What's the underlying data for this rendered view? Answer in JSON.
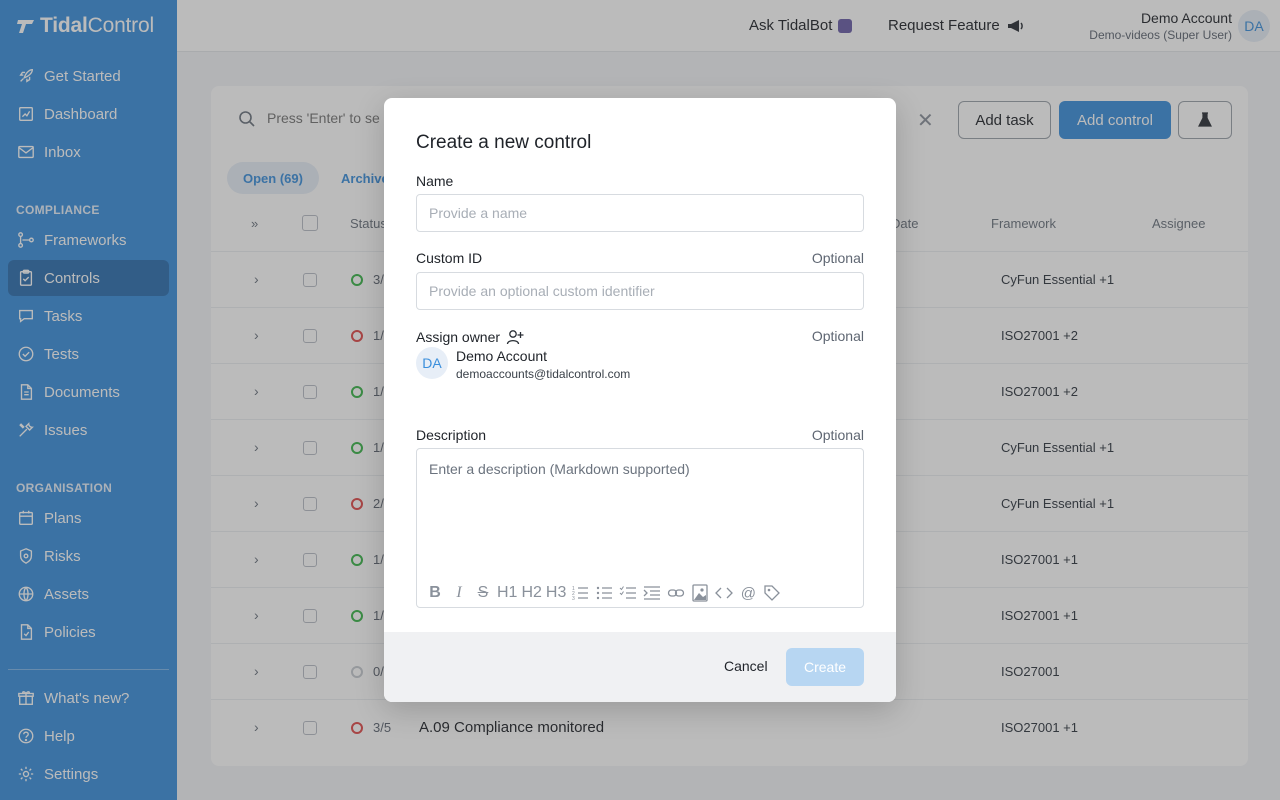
{
  "app": {
    "logo_bold": "Tidal",
    "logo_light": "Control"
  },
  "sidebar": {
    "items": [
      {
        "label": "Get Started",
        "icon": "rocket-icon"
      },
      {
        "label": "Dashboard",
        "icon": "chart-icon"
      },
      {
        "label": "Inbox",
        "icon": "mail-icon"
      },
      {
        "label": "Frameworks",
        "icon": "frameworks-icon"
      },
      {
        "label": "Controls",
        "icon": "clipboard-icon",
        "active": true
      },
      {
        "label": "Tasks",
        "icon": "chat-icon"
      },
      {
        "label": "Tests",
        "icon": "check-circle-icon"
      },
      {
        "label": "Documents",
        "icon": "document-icon"
      },
      {
        "label": "Issues",
        "icon": "tools-icon"
      },
      {
        "label": "Plans",
        "icon": "calendar-icon"
      },
      {
        "label": "Risks",
        "icon": "shield-icon"
      },
      {
        "label": "Assets",
        "icon": "globe-icon"
      },
      {
        "label": "Policies",
        "icon": "policy-icon"
      },
      {
        "label": "What's new?",
        "icon": "gift-icon"
      },
      {
        "label": "Help",
        "icon": "help-icon"
      },
      {
        "label": "Settings",
        "icon": "gear-icon"
      }
    ],
    "sections": {
      "compliance": "COMPLIANCE",
      "organisation": "ORGANISATION"
    }
  },
  "header": {
    "ask_bot": "Ask TidalBot",
    "request_feature": "Request Feature",
    "user_name": "Demo Account",
    "user_sub": "Demo-videos (Super User)",
    "avatar": "DA"
  },
  "controls": {
    "search_placeholder": "Press 'Enter' to se",
    "add_task": "Add task",
    "add_control": "Add control",
    "tabs": {
      "open": "Open (69)",
      "archived": "Archive"
    },
    "columns": {
      "toggle": "»",
      "status": "Status",
      "date": "Date",
      "framework": "Framework",
      "assignee": "Assignee"
    },
    "rows": [
      {
        "count": "3/",
        "framework": "CyFun Essential +1",
        "ring": "#3bb54a",
        "title": ""
      },
      {
        "count": "1/",
        "framework": "ISO27001 +2",
        "ring": "#e04b4b",
        "title": ""
      },
      {
        "count": "1/",
        "framework": "ISO27001 +2",
        "ring": "#3bb54a",
        "title": ""
      },
      {
        "count": "1/",
        "framework": "CyFun Essential +1",
        "ring": "#3bb54a",
        "title": ""
      },
      {
        "count": "2/",
        "framework": "CyFun Essential +1",
        "ring": "#e04b4b",
        "title": ""
      },
      {
        "count": "1/",
        "framework": "ISO27001 +1",
        "ring": "#3bb54a",
        "title": ""
      },
      {
        "count": "1/",
        "framework": "ISO27001 +1",
        "ring": "#3bb54a",
        "title": ""
      },
      {
        "count": "0/",
        "framework": "ISO27001",
        "ring": "#c6cbd1",
        "title": ""
      },
      {
        "count": "3/5",
        "framework": "ISO27001 +1",
        "ring": "#e04b4b",
        "title": "A.09 Compliance monitored"
      }
    ]
  },
  "modal": {
    "title": "Create a new control",
    "name_label": "Name",
    "name_placeholder": "Provide a name",
    "custom_id_label": "Custom ID",
    "optional": "Optional",
    "custom_id_placeholder": "Provide an optional custom identifier",
    "owner_label": "Assign owner",
    "owner_avatar": "DA",
    "owner_name": "Demo Account",
    "owner_email": "demoaccounts@tidalcontrol.com",
    "description_label": "Description",
    "description_placeholder": "Enter a description (Markdown supported)",
    "toolbar": [
      "B",
      "I",
      "S",
      "H1",
      "H2",
      "H3",
      "ordered-list-icon",
      "bullet-list-icon",
      "task-list-icon",
      "indent-icon",
      "link-icon",
      "image-icon",
      "code-icon",
      "mention-icon",
      "tag-icon"
    ],
    "cancel": "Cancel",
    "create": "Create"
  }
}
